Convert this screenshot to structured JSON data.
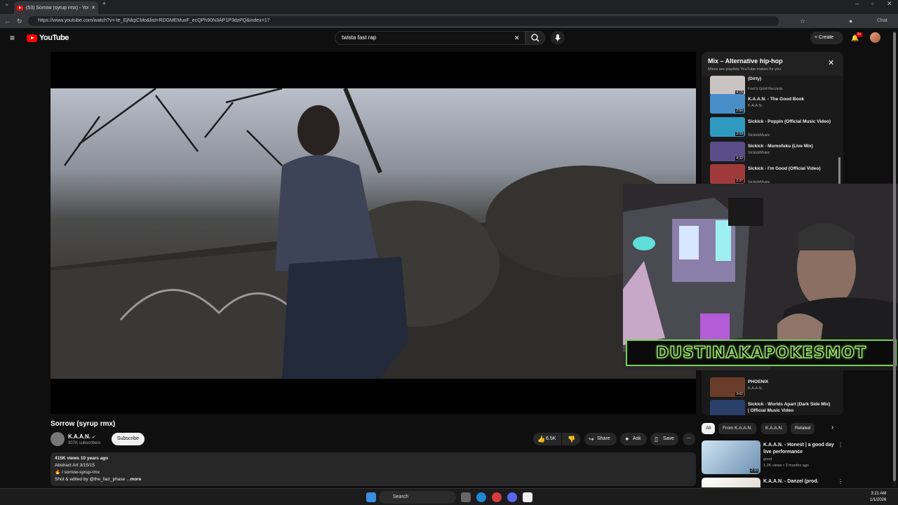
{
  "browser": {
    "tab_title": "(53) Sorrow (syrup rmx) - You",
    "url": "https://www.youtube.com/watch?v=-te_EjNkpCMo&list=RDGMEMuxF_ecQPh90N3AP1P3dzPQ&index=17",
    "chat_label": "Chat"
  },
  "youtube": {
    "logo_text": "YouTube",
    "search_query": "twista fast rap",
    "create_label": "Create",
    "notification_count": "9+"
  },
  "video": {
    "title": "Sorrow (syrup rmx)",
    "channel": "K.A.A.N.",
    "subscribers": "307K subscribers",
    "subscribe_label": "Subscribe",
    "likes": "6.5K",
    "share_label": "Share",
    "ask_label": "Ask",
    "save_label": "Save",
    "description": {
      "stats": "415K views  10 years ago",
      "line1": "Abstract Art 3/15/15",
      "line2": "🔥 / sorrow-syrup-rmx",
      "line3": "Shot & edited by @the_faiz_phase ...",
      "more": "more"
    }
  },
  "mix": {
    "title": "Mix – Alternative hip-hop",
    "subtitle": "Mixes are playlists YouTube makes for you",
    "items": [
      {
        "title": "(Dirty)",
        "channel": "Fool's Gold Records",
        "duration": "4:15"
      },
      {
        "title": "K.A.A.N. - The Good Book",
        "channel": "K.A.A.N.",
        "duration": "2:50"
      },
      {
        "title": "Sickick - Poppin (Official Music Video)",
        "channel": "SickickMusic",
        "duration": "2:09"
      },
      {
        "title": "Sickick - Momofuku (Live Mix)",
        "channel": "SickickMusic",
        "duration": "4:32"
      },
      {
        "title": "Sickick - I'm Good (Official Video)",
        "channel": "SickickMusic",
        "duration": "2:37"
      },
      {
        "title": "PHOENIX",
        "channel": "K.A.A.N.",
        "duration": "3:02"
      },
      {
        "title": "Sickick - Worlds Apart (Dark Side Mix) | Official Music Video",
        "channel": "",
        "duration": ""
      }
    ]
  },
  "streamer_tag": "DUSTINAKAPOKESMOT",
  "chips": [
    "All",
    "From K.A.A.N.",
    "K.A.A.N.",
    "Related"
  ],
  "recommendations": [
    {
      "title": "K.A.A.N. - Honest | a good day live performance",
      "channel": "good",
      "meta": "1.2K views • 2 months ago",
      "duration": "2:33"
    },
    {
      "title": "K.A.A.N. - Danzel (prod.",
      "channel": "",
      "meta": "",
      "duration": ""
    }
  ],
  "taskbar": {
    "search_label": "Search",
    "time": "3:21 AM",
    "date": "1/1/2026"
  }
}
